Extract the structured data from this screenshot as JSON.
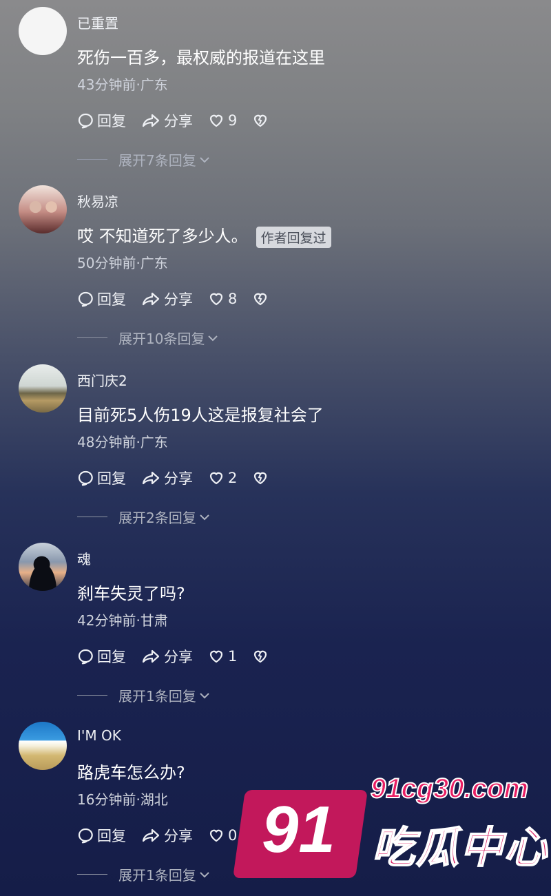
{
  "comments": [
    {
      "username": "已重置",
      "text": "死伤一百多，最权威的报道在这里",
      "badge": "",
      "meta": "43分钟前·广东",
      "reply": "回复",
      "share": "分享",
      "likes": "9",
      "expand": "展开7条回复",
      "avatar": "blank"
    },
    {
      "username": "秋易凉",
      "text": "哎 不知道死了多少人。",
      "badge": "作者回复过",
      "meta": "50分钟前·广东",
      "reply": "回复",
      "share": "分享",
      "likes": "8",
      "expand": "展开10条回复",
      "avatar": "couple"
    },
    {
      "username": "西门庆2",
      "text": "目前死5人伤19人这是报复社会了",
      "badge": "",
      "meta": "48分钟前·广东",
      "reply": "回复",
      "share": "分享",
      "likes": "2",
      "expand": "展开2条回复",
      "avatar": "wall"
    },
    {
      "username": "魂",
      "text": "刹车失灵了吗?",
      "badge": "",
      "meta": "42分钟前·甘肃",
      "reply": "回复",
      "share": "分享",
      "likes": "1",
      "expand": "展开1条回复",
      "avatar": "silhouette"
    },
    {
      "username": "I'M OK",
      "text": "路虎车怎么办?",
      "badge": "",
      "meta": "16分钟前·湖北",
      "reply": "回复",
      "share": "分享",
      "likes": "0",
      "expand": "展开1条回复",
      "avatar": "beach"
    }
  ],
  "watermark": {
    "number": "91",
    "url": "91cg30.com",
    "name": "吃瓜中心"
  },
  "colors": {
    "badge_bg": "#d7d9de",
    "watermark_pink": "#c2185b"
  }
}
